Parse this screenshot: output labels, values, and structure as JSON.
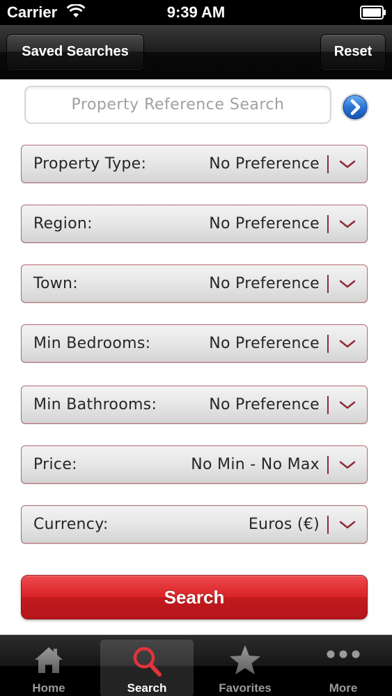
{
  "status_bar": {
    "carrier": "Carrier",
    "time": "9:39 AM",
    "wifi_icon": "wifi-icon",
    "battery_icon": "battery-icon"
  },
  "nav": {
    "left_button": "Saved Searches",
    "right_button": "Reset"
  },
  "reference_search": {
    "placeholder": "Property Reference Search",
    "value": "",
    "go_icon": "arrow-right-circle-icon"
  },
  "fields": [
    {
      "label": "Property Type:",
      "value": "No Preference"
    },
    {
      "label": "Region:",
      "value": "No Preference"
    },
    {
      "label": "Town:",
      "value": "No Preference"
    },
    {
      "label": "Min Bedrooms:",
      "value": "No Preference"
    },
    {
      "label": "Min Bathrooms:",
      "value": "No Preference"
    },
    {
      "label": "Price:",
      "value": "No Min - No Max"
    },
    {
      "label": "Currency:",
      "value": "Euros (€)"
    }
  ],
  "search_button": "Search",
  "tabs": [
    {
      "label": "Home",
      "icon": "house-icon",
      "active": false
    },
    {
      "label": "Search",
      "icon": "magnifier-icon",
      "active": true
    },
    {
      "label": "Favorites",
      "icon": "star-icon",
      "active": false
    },
    {
      "label": "More",
      "icon": "more-dots-icon",
      "active": false
    }
  ],
  "colors": {
    "accent_red": "#d92226",
    "field_border": "#b26870",
    "chevron": "#8c2b37",
    "go_button_blue": "#2a74d6"
  }
}
